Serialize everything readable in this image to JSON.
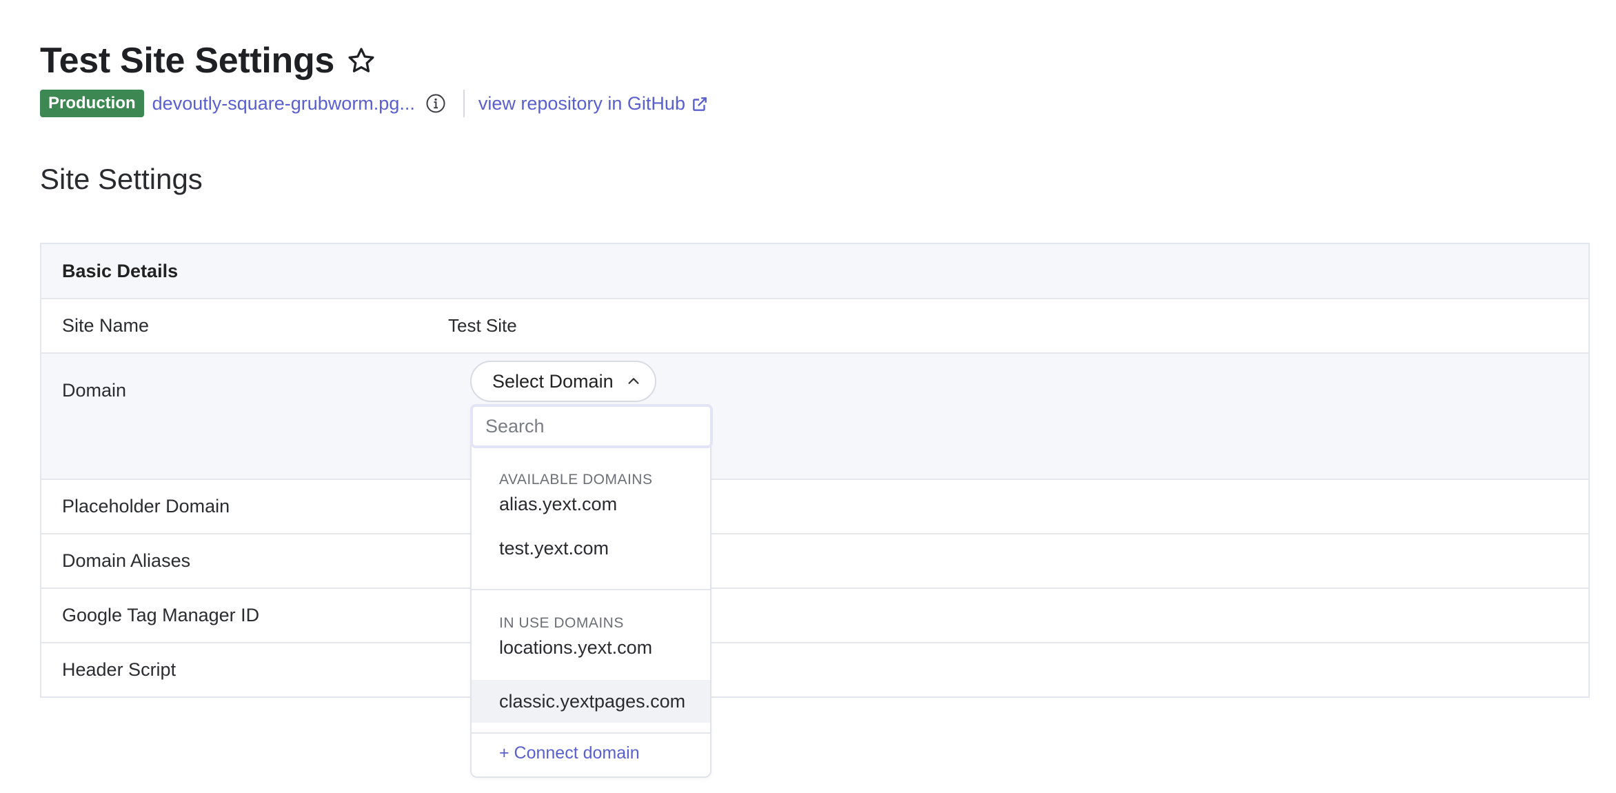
{
  "header": {
    "title": "Test Site Settings",
    "badge": "Production",
    "domain_link": "devoutly-square-grubworm.pg...",
    "repo_link": "view repository in GitHub"
  },
  "section_title": "Site Settings",
  "table": {
    "heading": "Basic Details",
    "rows": [
      {
        "label": "Site Name",
        "value": "Test Site"
      },
      {
        "label": "Domain"
      },
      {
        "label": "Placeholder Domain"
      },
      {
        "label": "Domain Aliases"
      },
      {
        "label": "Google Tag Manager ID"
      },
      {
        "label": "Header Script"
      }
    ]
  },
  "domain_select": {
    "button_label": "Select Domain",
    "search_placeholder": "Search",
    "available_label": "AVAILABLE DOMAINS",
    "available": [
      "alias.yext.com",
      "test.yext.com"
    ],
    "in_use_label": "IN USE DOMAINS",
    "in_use": [
      "locations.yext.com",
      "classic.yextpages.com"
    ],
    "connect_label": "+ Connect domain"
  },
  "colors": {
    "accent": "#5a5fcf",
    "badge": "#3d8752",
    "row_highlight": "#f6f7fb"
  },
  "icons": [
    "star-icon",
    "info-icon",
    "external-link-icon",
    "chevron-up-icon"
  ]
}
